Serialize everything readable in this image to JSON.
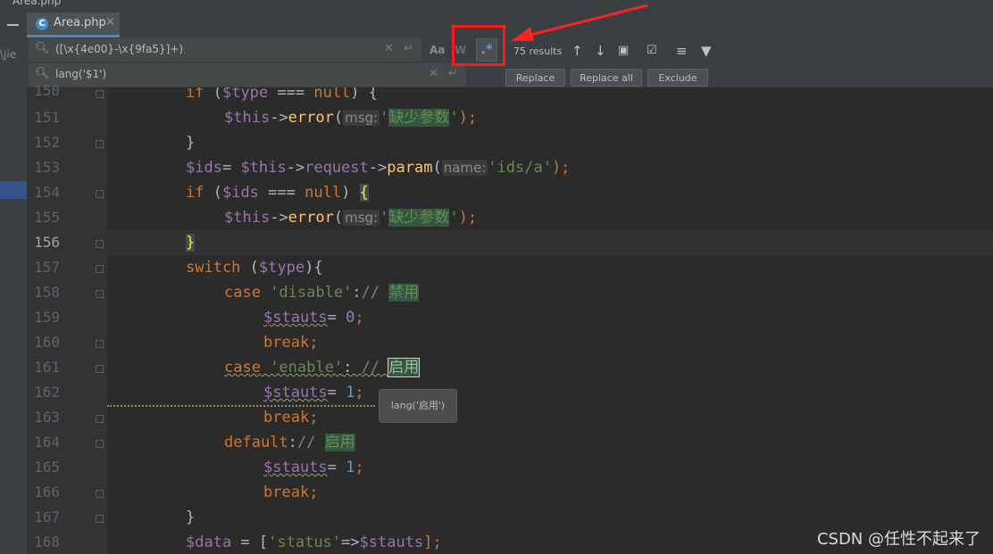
{
  "window": {
    "top_title": "Area.php"
  },
  "left_panel": {
    "cut_text": "\\jie"
  },
  "tab": {
    "label": "Area.php",
    "icon_letter": "C",
    "close": "×"
  },
  "find": {
    "search_value": "([\\x{4e00}-\\x{9fa5}]+)",
    "replace_value": "lang('$1')",
    "match_case": "Aa",
    "words": "W",
    "regex": ".*",
    "results": "75 results",
    "buttons": {
      "replace": "Replace",
      "replace_all": "Replace all",
      "exclude": "Exclude"
    }
  },
  "gutter": {
    "line_numbers": [
      "150",
      "151",
      "152",
      "153",
      "154",
      "155",
      "156",
      "157",
      "158",
      "159",
      "160",
      "161",
      "162",
      "163",
      "164",
      "165",
      "166",
      "167",
      "168"
    ],
    "current_line": "156"
  },
  "code": {
    "l150": {
      "kw1": "if",
      "p1": " (",
      "v1": "$type",
      "p2": " === ",
      "kw2": "null",
      "p3": ") {"
    },
    "l151": {
      "v1": "$this",
      "p1": "->",
      "fn": "error",
      "p2": "(",
      "hint": "msg:",
      "q1": "'",
      "cn": "缺少参数",
      "q2": "'",
      "p3": ");"
    },
    "l152": {
      "p1": "}"
    },
    "l153": {
      "v1": "$ids",
      "p1": "= ",
      "v2": "$this",
      "p2": "->",
      "v3": "request",
      "p3": "->",
      "fn": "param",
      "p4": "(",
      "hint": "name:",
      "s1": "'ids/a'",
      "p5": ");"
    },
    "l154": {
      "kw1": "if",
      "p1": " (",
      "v1": "$ids",
      "p2": " === ",
      "kw2": "null",
      "p3": ") ",
      "brace": "{"
    },
    "l155": {
      "v1": "$this",
      "p1": "->",
      "fn": "error",
      "p2": "(",
      "hint": "msg:",
      "q1": "'",
      "cn": "缺少参数",
      "q2": "'",
      "p3": ");"
    },
    "l156": {
      "brace": "}"
    },
    "l157": {
      "kw1": "switch",
      "p1": " (",
      "v1": "$type",
      "p2": "){"
    },
    "l158": {
      "kw1": "case",
      "s1": " 'disable'",
      "p1": ":",
      "cm": "// ",
      "cn": "禁用"
    },
    "l159": {
      "v1": "$stauts",
      "p1": "= ",
      "n1": "0",
      "p2": ";"
    },
    "l160": {
      "kw1": "break",
      "p1": ";"
    },
    "l161": {
      "kw1": "case",
      "s1": " 'enable'",
      "p1": ": ",
      "cm": "// ",
      "cn": "启用"
    },
    "l162": {
      "v1": "$stauts",
      "p1": "= ",
      "n1": "1",
      "p2": ";"
    },
    "l163": {
      "kw1": "break",
      "p1": ";"
    },
    "l164": {
      "kw1": "default",
      "p1": ":",
      "cm": "// ",
      "cn": "启用"
    },
    "l165": {
      "v1": "$stauts",
      "p1": "= ",
      "n1": "1",
      "p2": ";"
    },
    "l166": {
      "kw1": "break",
      "p1": ";"
    },
    "l167": {
      "p1": "}"
    },
    "l168": {
      "v1": "$data",
      "p1": " = [",
      "s1": "'status'",
      "p2": "=>",
      "v2": "$stauts",
      "p3": "];"
    }
  },
  "tooltip": "lang('启用')",
  "watermark": "CSDN @任性不起来了"
}
